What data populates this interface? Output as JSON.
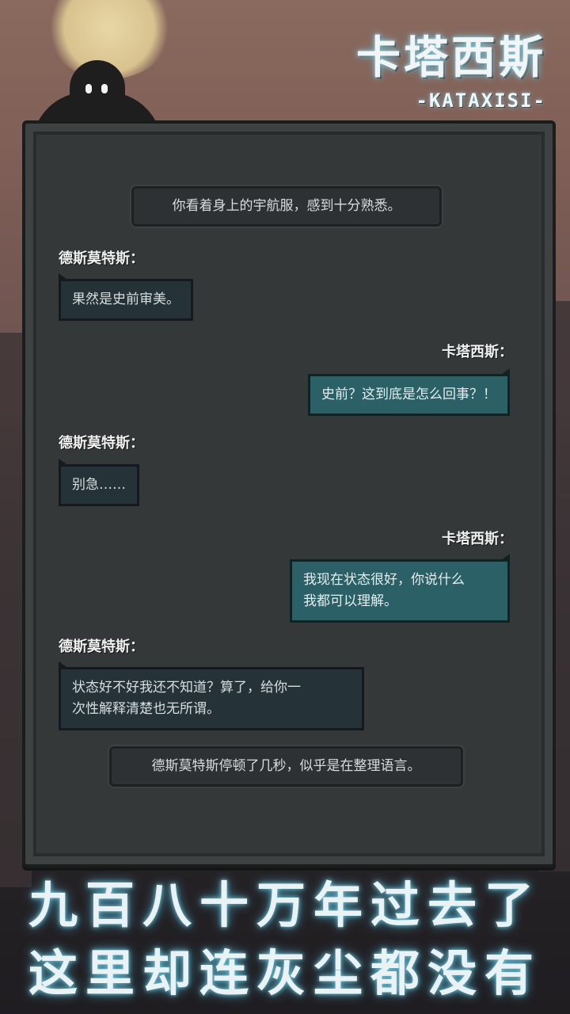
{
  "title": {
    "main": "卡塔西斯",
    "sub": "-KATAXISI-"
  },
  "dialogue": {
    "narration_1": "你看着身上的宇航服，感到十分熟悉。",
    "speaker_1": "德斯莫特斯：",
    "msg_1": "果然是史前审美。",
    "speaker_2": "卡塔西斯：",
    "msg_2": "史前？这到底是怎么回事？！",
    "speaker_3": "德斯莫特斯：",
    "msg_3": "别急……",
    "speaker_4": "卡塔西斯：",
    "msg_4_line1": "我现在状态很好，你说什么",
    "msg_4_line2": "我都可以理解。",
    "speaker_5": "德斯莫特斯：",
    "msg_5_line1": "状态好不好我还不知道？算了，给你一",
    "msg_5_line2": "次性解释清楚也无所谓。",
    "narration_2": "德斯莫特斯停顿了几秒，似乎是在整理语言。"
  },
  "slogan": {
    "line1": "九百八十万年过去了",
    "line2": "这里却连灰尘都没有"
  },
  "colors": {
    "panel": "#353838",
    "bubble_left": "#253238",
    "bubble_right": "#2a6066",
    "text": "#d7dede"
  }
}
